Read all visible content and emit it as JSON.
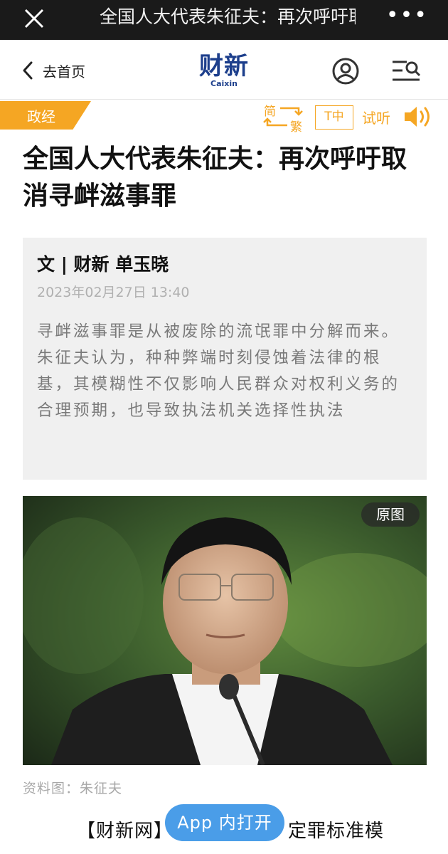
{
  "topbar": {
    "title": "全国人大代表朱征夫：再次呼吁取消寻衅滋事罪",
    "more": "•••"
  },
  "header": {
    "back_label": "去首页",
    "logo_cn": "财新",
    "logo_en": "Caixin"
  },
  "toolbar": {
    "category": "政经",
    "convert_simplified": "简",
    "convert_traditional": "繁",
    "font_size": "T中",
    "listen": "试听"
  },
  "article": {
    "headline": "全国人大代表朱征夫：再次呼吁取消寻衅滋事罪",
    "author": "文 | 财新 单玉晓",
    "date": "2023年02月27日 13:40",
    "summary": "寻衅滋事罪是从被废除的流氓罪中分解而来。朱征夫认为，种种弊端时刻侵蚀着法律的根基，其模糊性不仅影响人民群众对权利义务的合理预期，也导致执法机关选择性执法",
    "photo_badge": "原图",
    "caption": "资料图：朱征夫",
    "body_start": "【财新网】寻衅滋事罪，定罪标准模"
  },
  "app_button": "App 内打开",
  "colors": {
    "accent": "#f5a623",
    "brand": "#1d3f8c",
    "app_button": "#4a9de8"
  }
}
